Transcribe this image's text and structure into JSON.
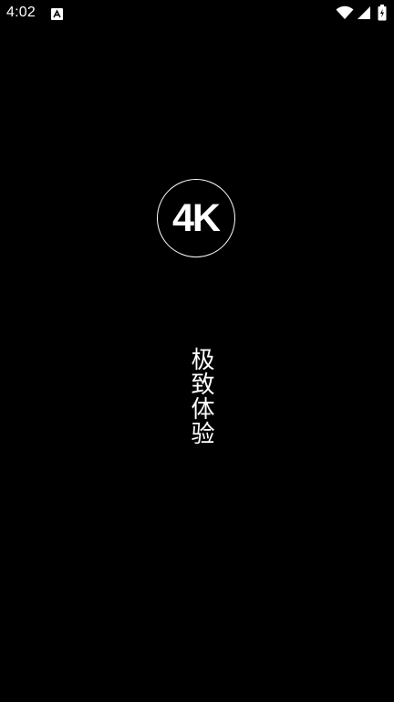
{
  "status_bar": {
    "time": "4:02",
    "notification_icon": "app-notification-icon",
    "wifi_icon": "wifi-icon",
    "signal_icon": "cellular-signal-icon",
    "battery_icon": "battery-icon"
  },
  "splash": {
    "logo_text": "4K",
    "tagline": "极致体验"
  },
  "colors": {
    "background": "#000000",
    "foreground": "#ffffff"
  }
}
